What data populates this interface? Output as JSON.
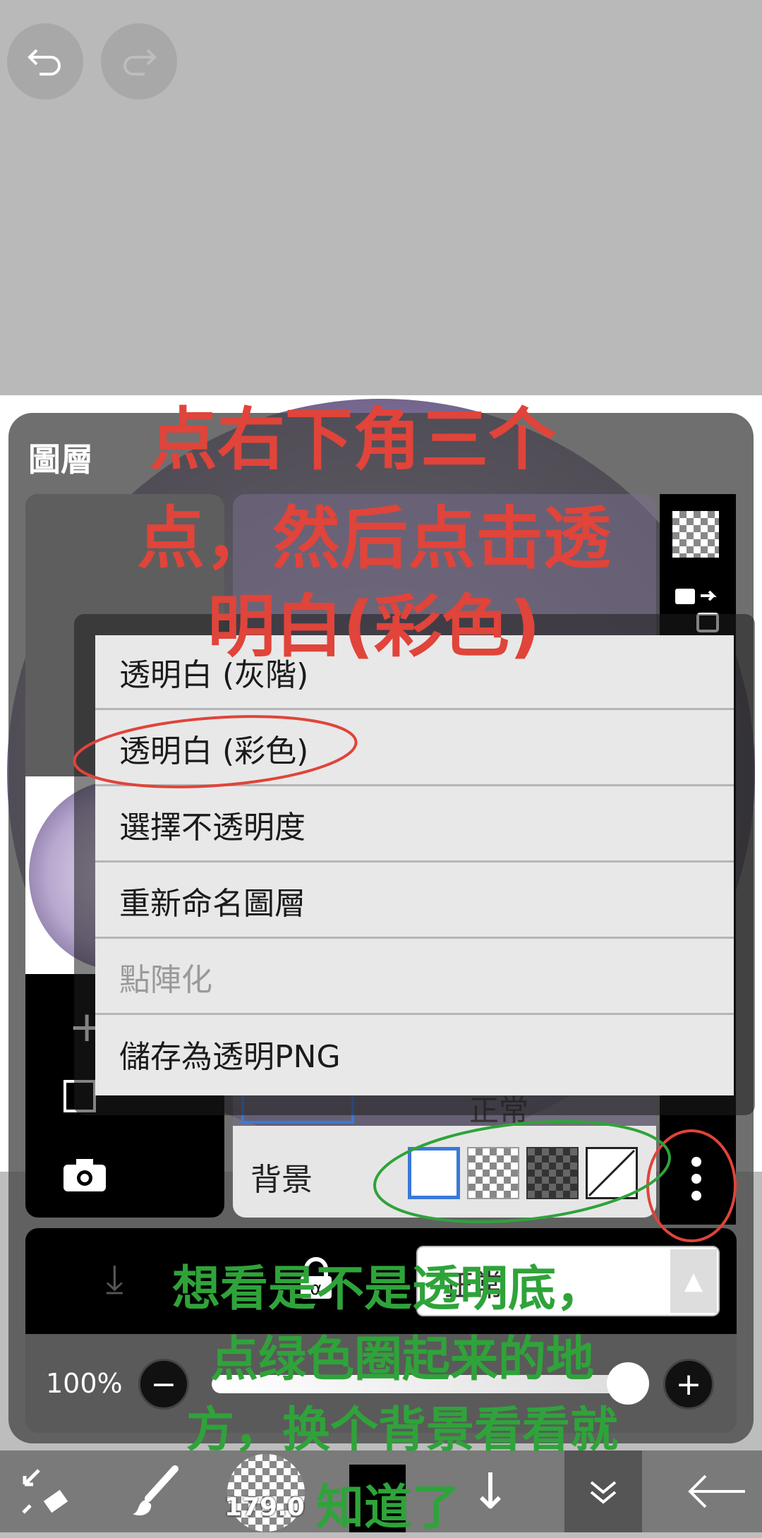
{
  "panel": {
    "title": "圖層"
  },
  "menu": {
    "items": [
      {
        "label": "透明白 (灰階)",
        "enabled": true
      },
      {
        "label": "透明白 (彩色)",
        "enabled": true
      },
      {
        "label": "選擇不透明度",
        "enabled": true
      },
      {
        "label": "重新命名圖層",
        "enabled": true
      },
      {
        "label": "點陣化",
        "enabled": false
      },
      {
        "label": "儲存為透明PNG",
        "enabled": true
      }
    ]
  },
  "layer": {
    "blend_mode_partial": "正常"
  },
  "background": {
    "label": "背景",
    "options": [
      "white",
      "light-checker",
      "dark-checker",
      "none"
    ],
    "selected": "white"
  },
  "blend": {
    "mode": "正常"
  },
  "opacity": {
    "value": "100%"
  },
  "brush": {
    "size": "179.0"
  },
  "annotations": {
    "red": [
      "点右下角三个",
      "点，然后点击透",
      "明白(彩色)"
    ],
    "green": [
      "想看是不是透明底，",
      "点绿色圈起来的地",
      "方，换个背景看看就",
      "知道了"
    ]
  },
  "colors": {
    "annotation_red": "#e0443a",
    "annotation_green": "#2fa33a",
    "selected_swatch_border": "#3a78d8"
  },
  "icons": [
    "undo-icon",
    "redo-icon",
    "transparency-icon",
    "swap-layer-icon",
    "add-layer-icon",
    "camera-icon",
    "lock-icon",
    "more-icon",
    "brush-icon",
    "transform-icon",
    "move-down-icon",
    "collapse-icon",
    "back-arrow-icon"
  ]
}
